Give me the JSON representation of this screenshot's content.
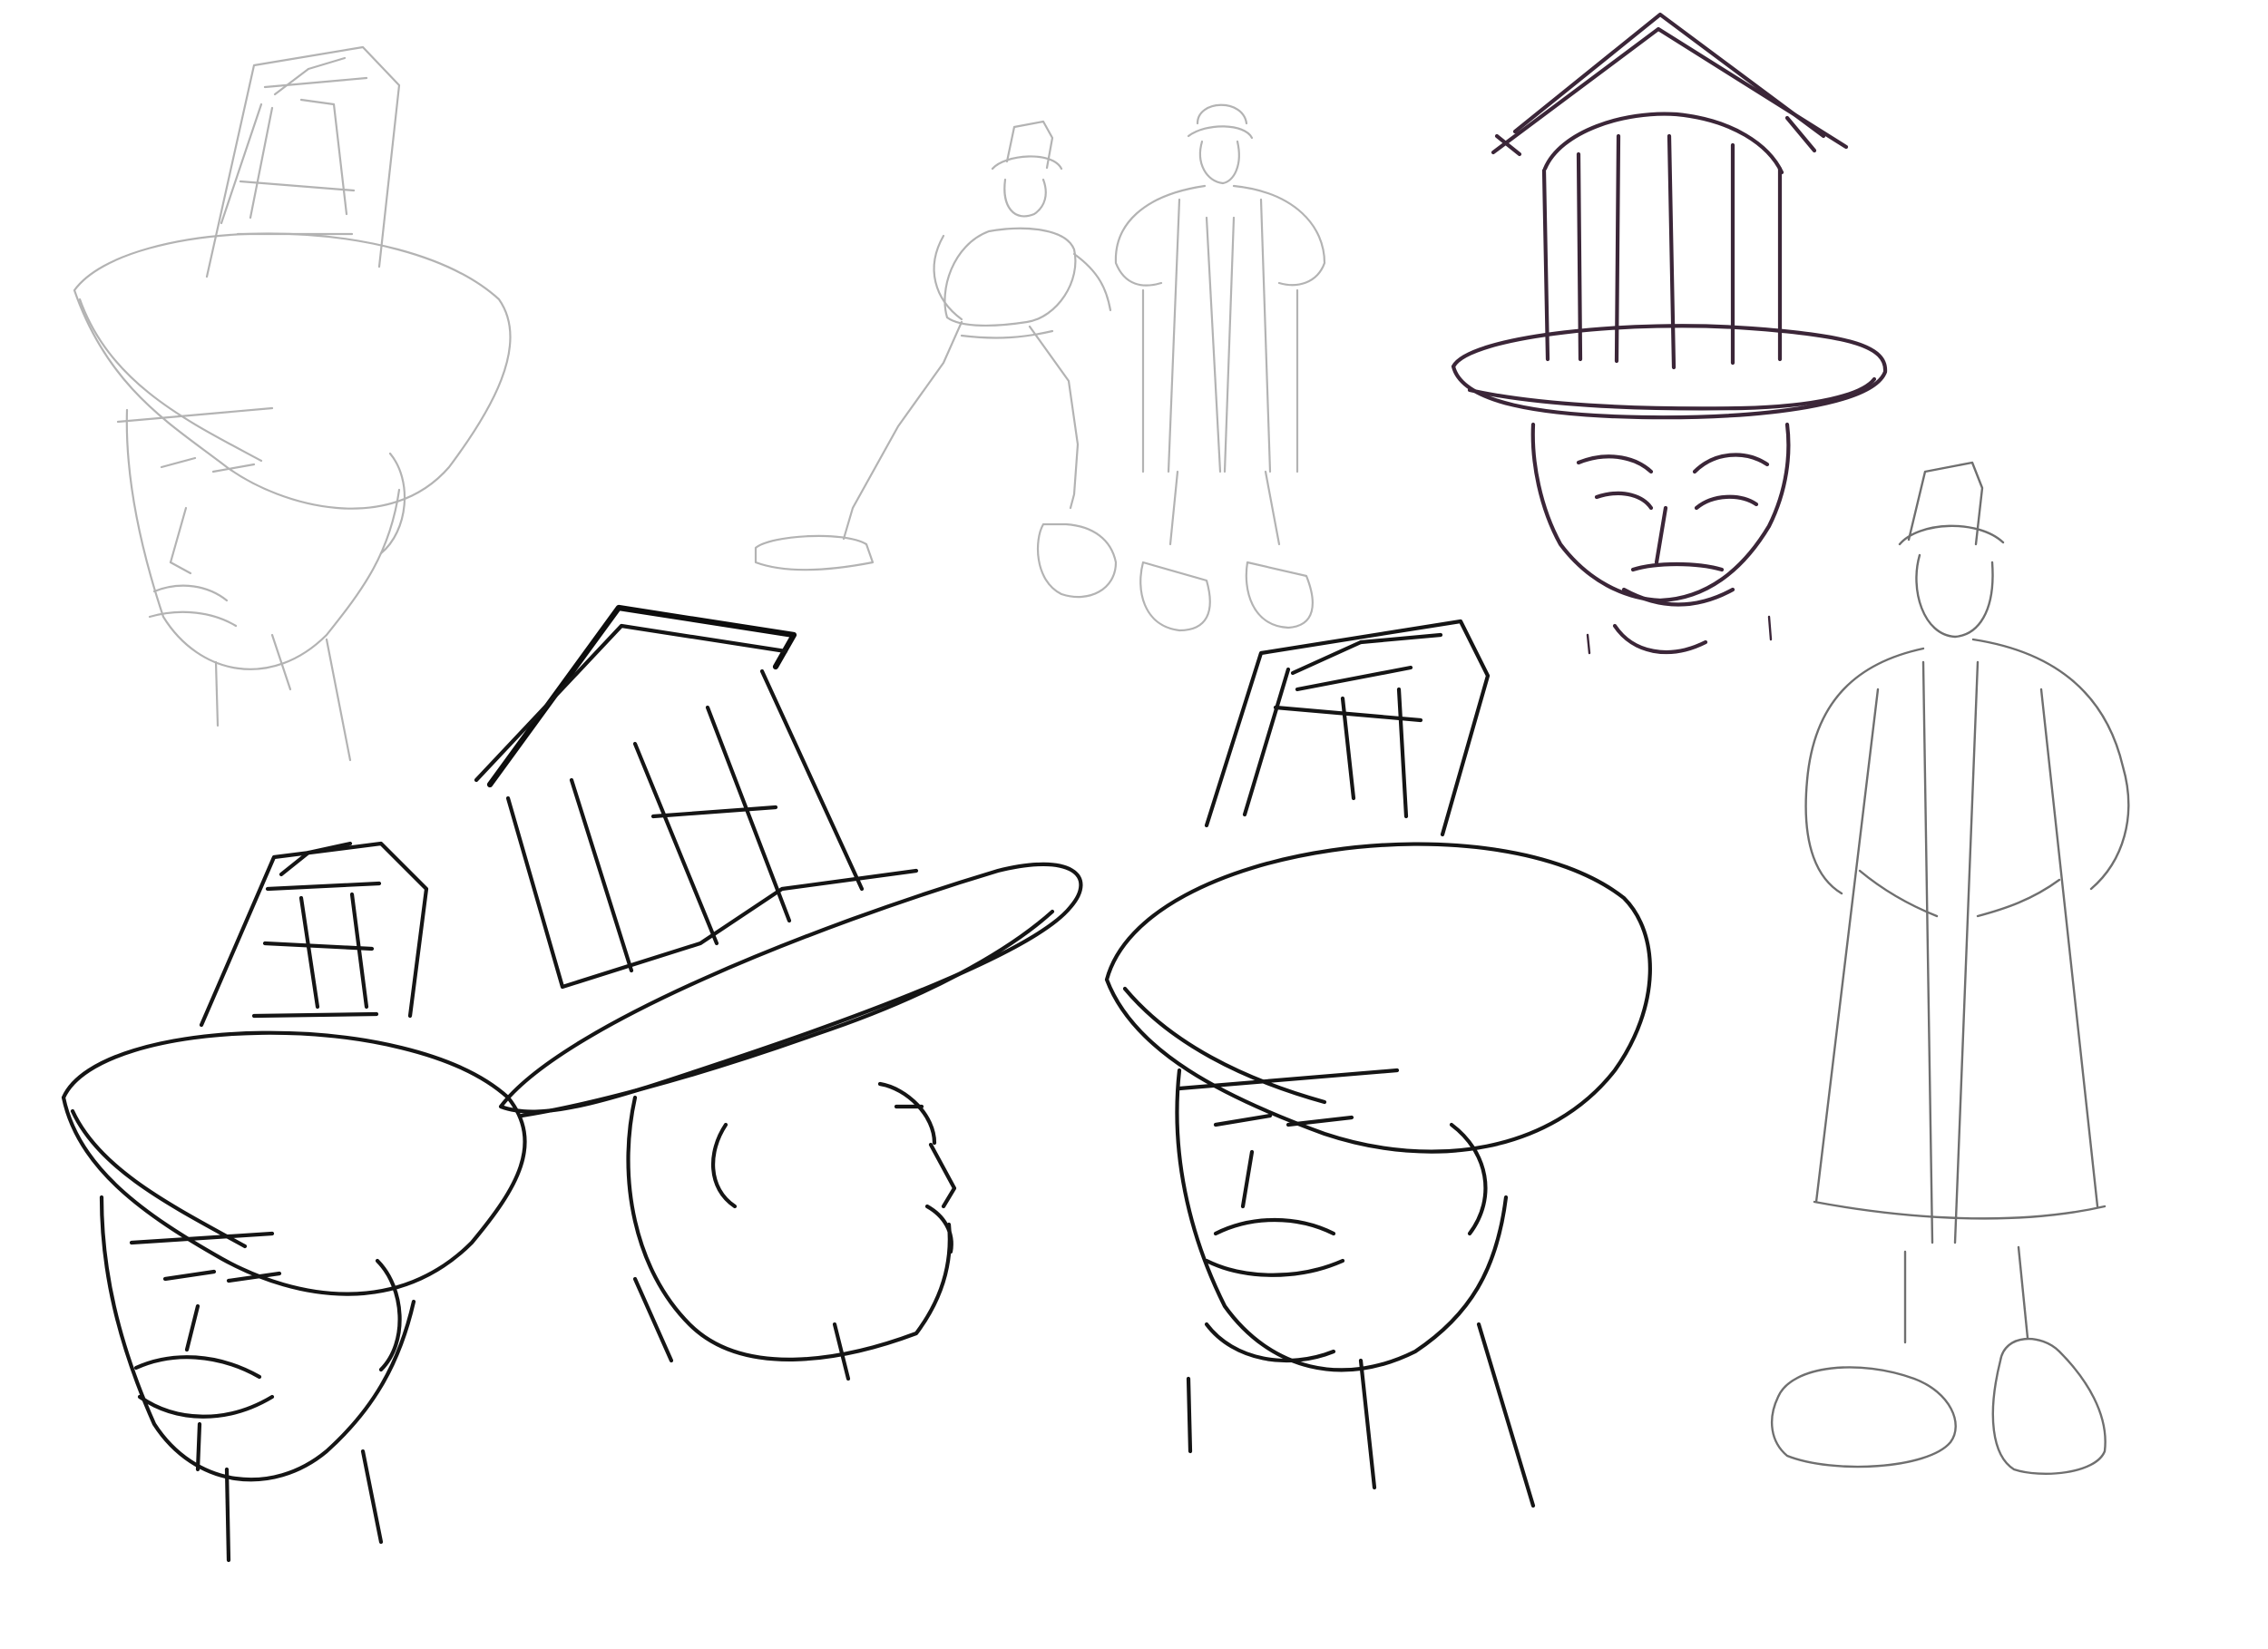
{
  "sheet": {
    "background": "#ffffff",
    "ink_colors": {
      "light": "#9a9a9a",
      "mid": "#6f6f6f",
      "dark": "#151515",
      "purple": "#3b2638"
    }
  },
  "sketches": [
    {
      "id": "top-left-head",
      "tone": "light"
    },
    {
      "id": "small-dynamic-pose",
      "tone": "light"
    },
    {
      "id": "small-standing-coat-figure",
      "tone": "light"
    },
    {
      "id": "front-face-top-hat",
      "tone": "purple"
    },
    {
      "id": "standing-coat-figure",
      "tone": "mid"
    },
    {
      "id": "bottom-left-grinning-head",
      "tone": "dark"
    },
    {
      "id": "profile-head-leaning-hat",
      "tone": "dark"
    },
    {
      "id": "three-quarter-head",
      "tone": "dark"
    }
  ]
}
